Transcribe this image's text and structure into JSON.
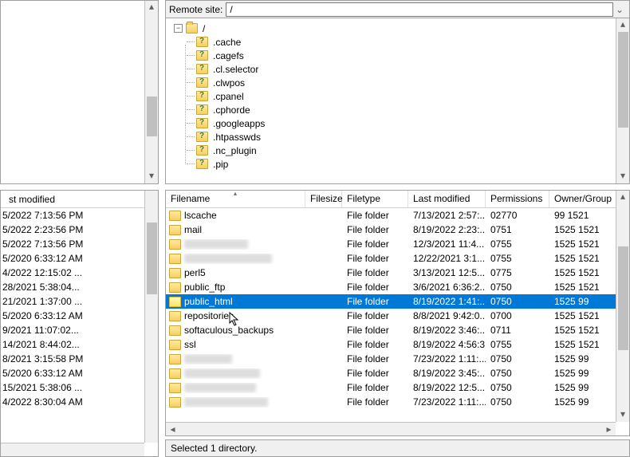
{
  "remote": {
    "label": "Remote site:",
    "path": "/"
  },
  "tree": {
    "root": "/",
    "items": [
      ".cache",
      ".cagefs",
      ".cl.selector",
      ".clwpos",
      ".cpanel",
      ".cphorde",
      ".googleapps",
      ".htpasswds",
      ".nc_plugin",
      ".pip"
    ]
  },
  "left": {
    "header": "st modified",
    "rows": [
      "5/2022 7:13:56 PM",
      "5/2022 2:23:56 PM",
      "5/2022 7:13:56 PM",
      "5/2020 6:33:12 AM",
      "4/2022 12:15:02 ...",
      "28/2021 5:38:04...",
      "21/2021 1:37:00 ...",
      "5/2020 6:33:12 AM",
      "9/2021 11:07:02...",
      "14/2021 8:44:02...",
      "8/2021 3:15:58 PM",
      "5/2020 6:33:12 AM",
      "15/2021 5:38:06 ...",
      "4/2022 8:30:04 AM"
    ]
  },
  "table": {
    "headers": {
      "filename": "Filename",
      "filesize": "Filesize",
      "filetype": "Filetype",
      "last_modified": "Last modified",
      "permissions": "Permissions",
      "owner": "Owner/Group"
    },
    "rows": [
      {
        "name": "lscache",
        "type": "File folder",
        "mod": "7/13/2021 2:57:...",
        "perm": "02770",
        "own": "99 1521"
      },
      {
        "name": "mail",
        "type": "File folder",
        "mod": "8/19/2022 2:23:...",
        "perm": "0751",
        "own": "1525 1521"
      },
      {
        "name": "",
        "blur": 80,
        "type": "File folder",
        "mod": "12/3/2021 11:4...",
        "perm": "0755",
        "own": "1525 1521"
      },
      {
        "name": "",
        "blur": 110,
        "type": "File folder",
        "mod": "12/22/2021 3:1...",
        "perm": "0755",
        "own": "1525 1521"
      },
      {
        "name": "perl5",
        "type": "File folder",
        "mod": "3/13/2021 12:5...",
        "perm": "0775",
        "own": "1525 1521"
      },
      {
        "name": "public_ftp",
        "type": "File folder",
        "mod": "3/6/2021 6:36:2...",
        "perm": "0750",
        "own": "1525 1521"
      },
      {
        "name": "public_html",
        "type": "File folder",
        "mod": "8/19/2022 1:41:...",
        "perm": "0750",
        "own": "1525 99",
        "selected": true
      },
      {
        "name": "repositories",
        "type": "File folder",
        "mod": "8/8/2021 9:42:0...",
        "perm": "0700",
        "own": "1525 1521"
      },
      {
        "name": "softaculous_backups",
        "type": "File folder",
        "mod": "8/19/2022 3:46:...",
        "perm": "0711",
        "own": "1525 1521"
      },
      {
        "name": "ssl",
        "type": "File folder",
        "mod": "8/19/2022 4:56:3...",
        "perm": "0755",
        "own": "1525 1521"
      },
      {
        "name": "",
        "blur": 60,
        "type": "File folder",
        "mod": "7/23/2022 1:11:...",
        "perm": "0750",
        "own": "1525 99"
      },
      {
        "name": "",
        "blur": 95,
        "type": "File folder",
        "mod": "8/19/2022 3:45:...",
        "perm": "0750",
        "own": "1525 99"
      },
      {
        "name": "",
        "blur": 90,
        "type": "File folder",
        "mod": "8/19/2022 12:5...",
        "perm": "0750",
        "own": "1525 99"
      },
      {
        "name": "",
        "blur": 105,
        "type": "File folder",
        "mod": "7/23/2022 1:11:...",
        "perm": "0750",
        "own": "1525 99"
      }
    ]
  },
  "status": "Selected 1 directory."
}
